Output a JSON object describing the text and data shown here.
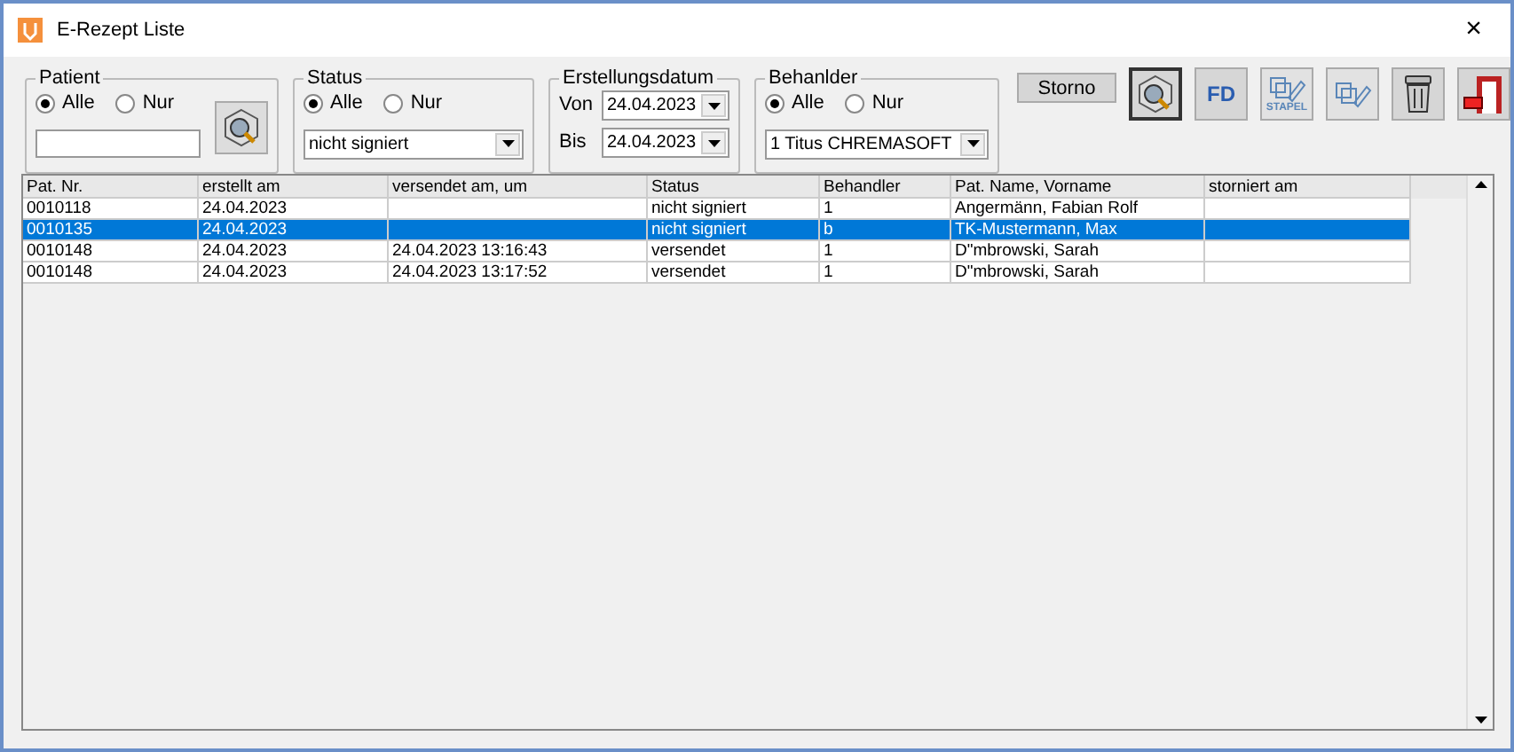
{
  "window": {
    "title": "E-Rezept Liste",
    "close": "×"
  },
  "filters": [
    {
      "kind": "text",
      "title": "Patient",
      "options": [
        {
          "label": "Alle",
          "selected": true
        },
        {
          "label": "Nur",
          "selected": false
        }
      ]
    },
    {
      "kind": "select",
      "title": "Status",
      "options": [
        {
          "label": "Alle",
          "selected": true
        },
        {
          "label": "Nur",
          "selected": false
        }
      ],
      "value": "nicht signiert"
    },
    {
      "kind": "dates",
      "title": "Erstellungsdatum",
      "dates": [
        {
          "label": "Von",
          "value": "24.04.2023"
        },
        {
          "label": "Bis",
          "value": "24.04.2023"
        }
      ]
    },
    {
      "kind": "select",
      "title": "Behanlder",
      "options": [
        {
          "label": "Alle",
          "selected": true
        },
        {
          "label": "Nur",
          "selected": false
        }
      ],
      "value": "1 Titus CHREMASOFT"
    }
  ],
  "toolbar": [
    {
      "kind": "text",
      "label": "Storno",
      "pressed": false,
      "disabled": false
    },
    {
      "kind": "search",
      "pressed": true,
      "disabled": false
    },
    {
      "kind": "fd",
      "label": "FD",
      "pressed": false,
      "disabled": false
    },
    {
      "kind": "stapel",
      "label": "STAPEL",
      "pressed": false,
      "disabled": true
    },
    {
      "kind": "edit",
      "pressed": false,
      "disabled": true
    },
    {
      "kind": "trash",
      "pressed": false,
      "disabled": false
    },
    {
      "kind": "exit",
      "pressed": false,
      "disabled": false
    }
  ],
  "table": {
    "columns": [
      "Pat. Nr.",
      "erstellt am",
      "versendet am, um",
      "Status",
      "Behandler",
      "Pat. Name, Vorname",
      "storniert am"
    ],
    "rows": [
      {
        "selected": false,
        "cells": [
          "0010118",
          "24.04.2023",
          "",
          "nicht signiert",
          "1",
          "Angermänn, Fabian Rolf",
          ""
        ]
      },
      {
        "selected": true,
        "cells": [
          "0010135",
          "24.04.2023",
          "",
          "nicht signiert",
          "b",
          "TK-Mustermann, Max",
          ""
        ]
      },
      {
        "selected": false,
        "cells": [
          "0010148",
          "24.04.2023",
          "24.04.2023 13:16:43",
          "versendet",
          "1",
          "D\"mbrowski, Sarah",
          ""
        ]
      },
      {
        "selected": false,
        "cells": [
          "0010148",
          "24.04.2023",
          "24.04.2023 13:17:52",
          "versendet",
          "1",
          "D\"mbrowski, Sarah",
          ""
        ]
      }
    ]
  }
}
